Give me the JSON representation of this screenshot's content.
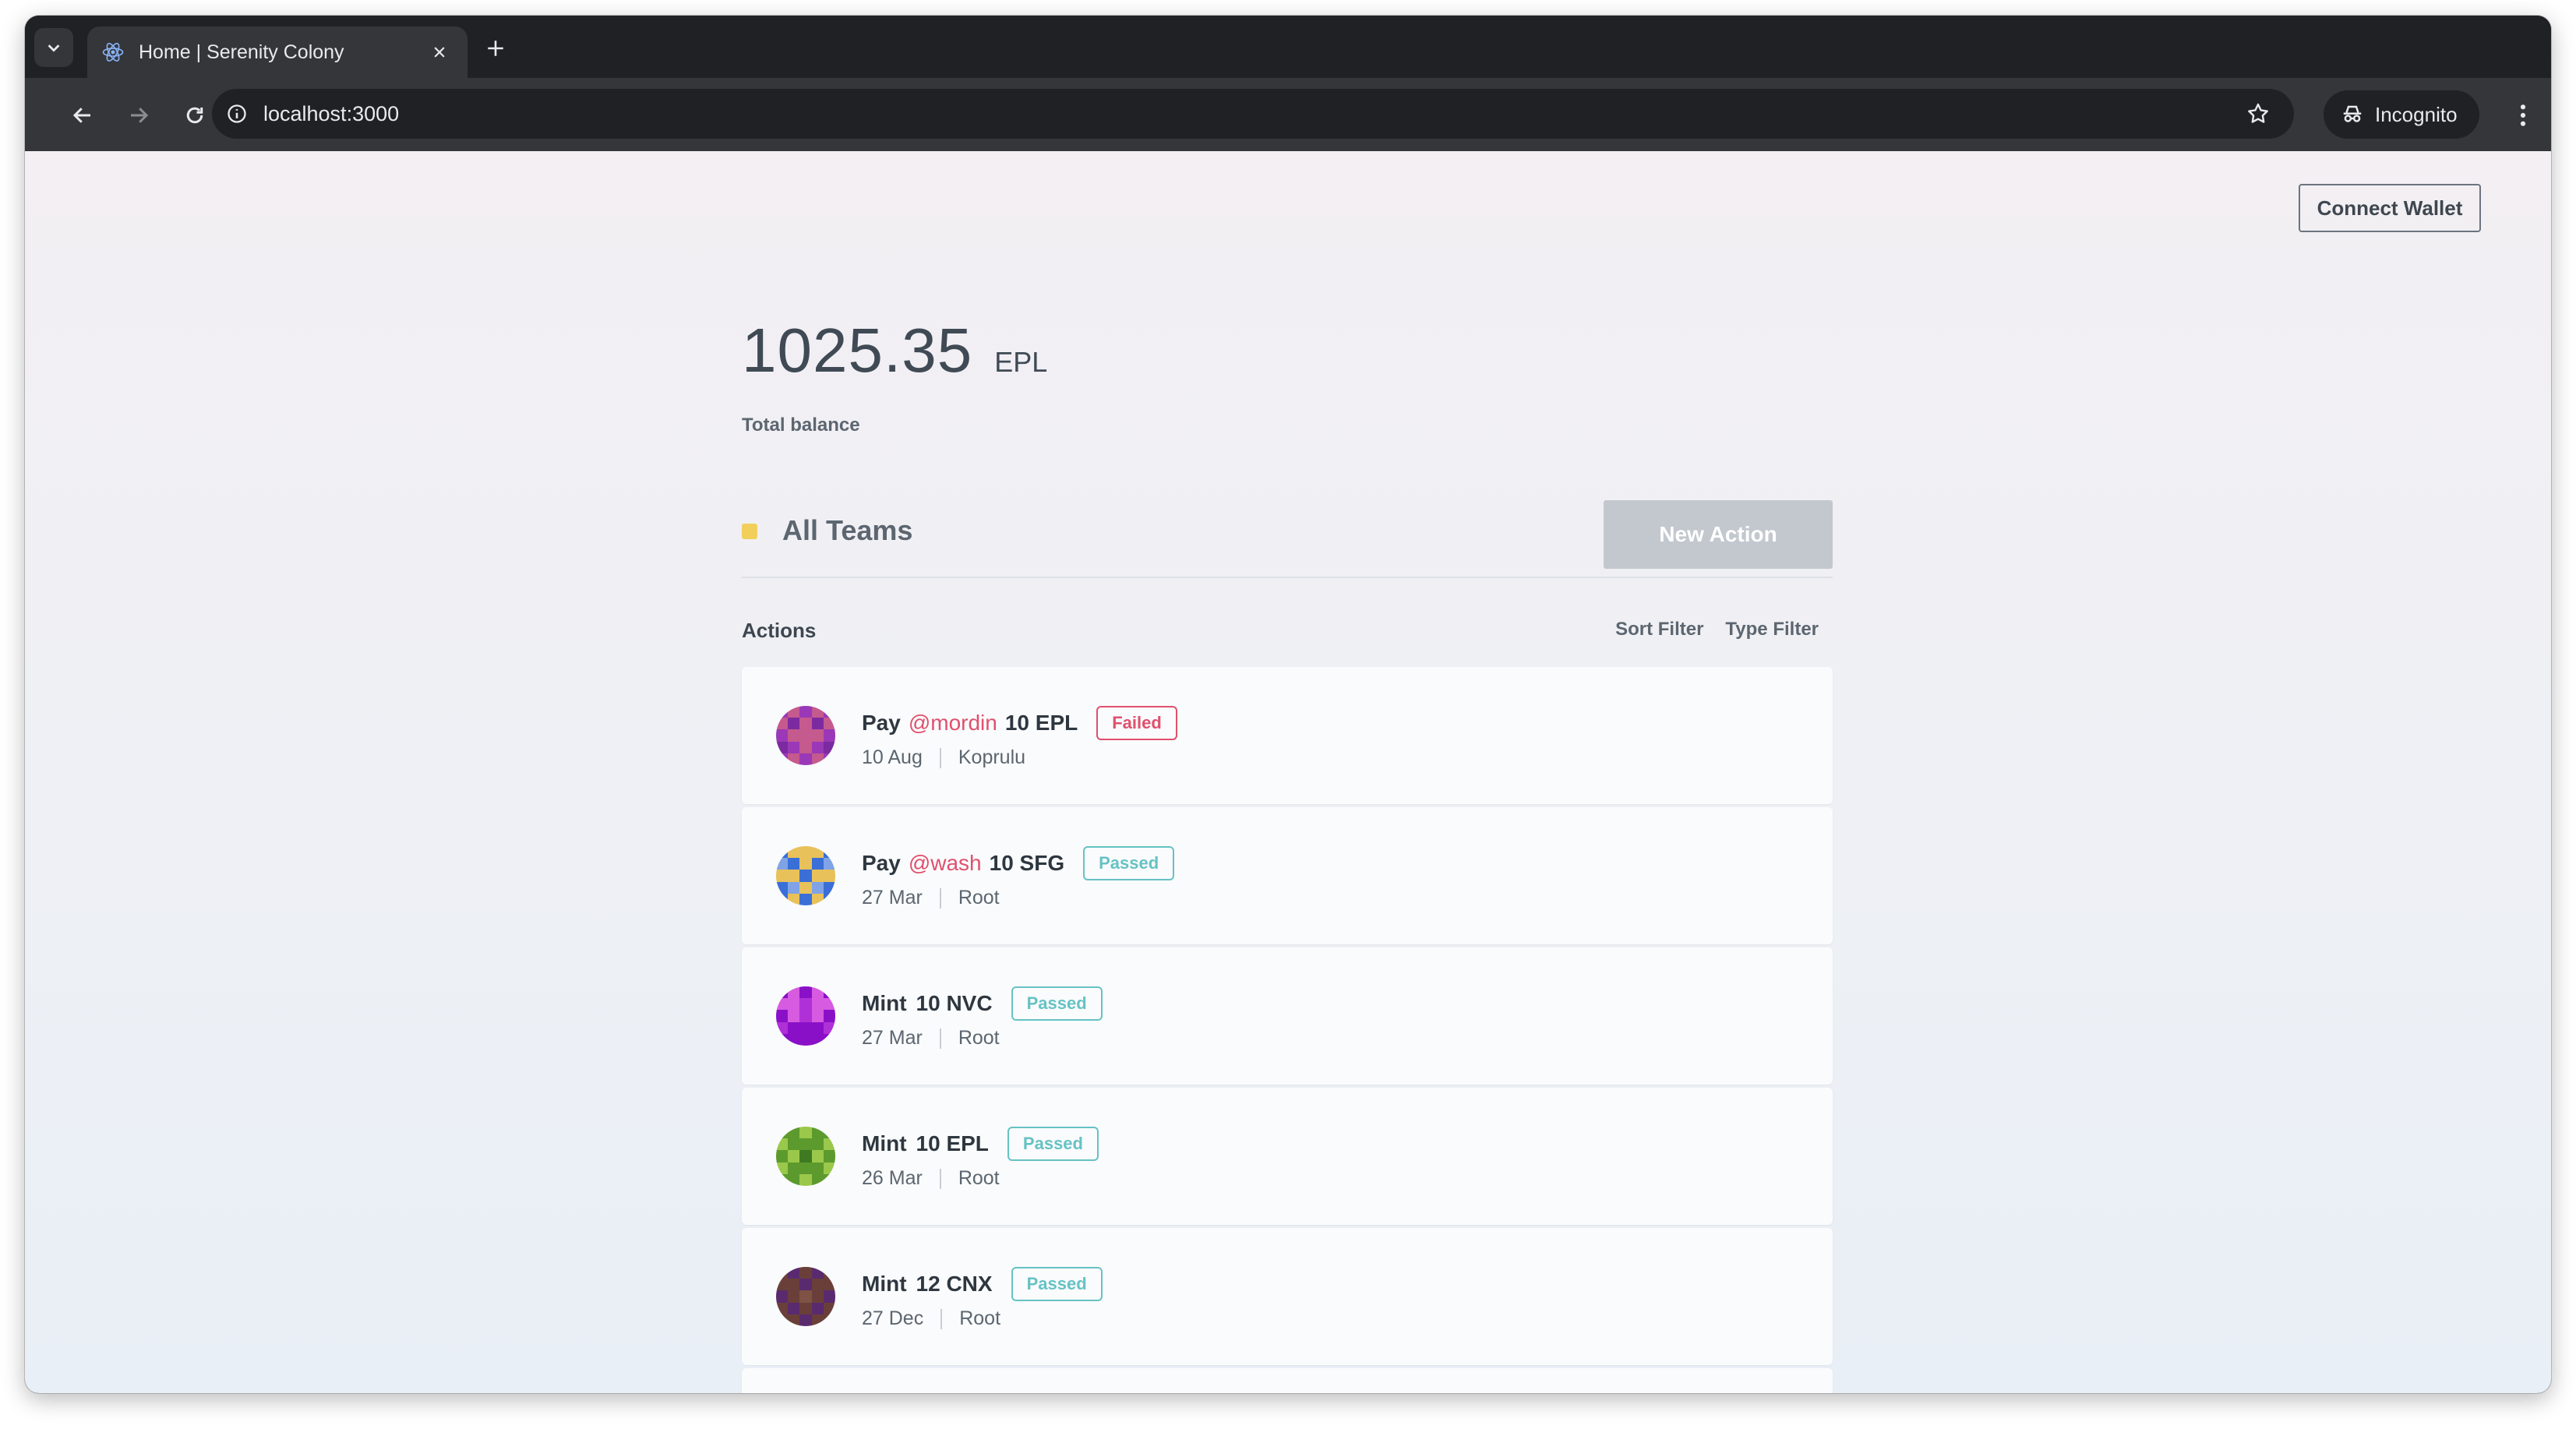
{
  "browser": {
    "tab_title": "Home | Serenity Colony",
    "url": "localhost:3000",
    "incognito_label": "Incognito",
    "icons": {
      "tab_search": "chevron-down-icon",
      "tab_favicon": "react-icon",
      "tab_close": "close-icon",
      "new_tab": "plus-icon",
      "back": "arrow-left-icon",
      "forward": "arrow-right-icon",
      "reload": "reload-icon",
      "site_info": "info-icon",
      "bookmark": "star-icon",
      "incognito": "incognito-icon",
      "menu": "kebab-menu-icon"
    }
  },
  "header": {
    "connect_wallet_label": "Connect Wallet"
  },
  "balance": {
    "value": "1025.35",
    "token": "EPL",
    "label": "Total balance"
  },
  "teams": {
    "selected_team": "All Teams",
    "team_color": "#f2cf5b",
    "new_action_label": "New Action"
  },
  "actions": {
    "title": "Actions",
    "sort_filter_label": "Sort Filter",
    "type_filter_label": "Type Filter",
    "items": [
      {
        "verb": "Pay",
        "recipient": "@mordin",
        "amount": "10 EPL",
        "status": "Failed",
        "date": "10 Aug",
        "team": "Koprulu"
      },
      {
        "verb": "Pay",
        "recipient": "@wash",
        "amount": "10 SFG",
        "status": "Passed",
        "date": "27 Mar",
        "team": "Root"
      },
      {
        "verb": "Mint",
        "recipient": "",
        "amount": "10 NVC",
        "status": "Passed",
        "date": "27 Mar",
        "team": "Root"
      },
      {
        "verb": "Mint",
        "recipient": "",
        "amount": "10 EPL",
        "status": "Passed",
        "date": "26 Mar",
        "team": "Root"
      },
      {
        "verb": "Mint",
        "recipient": "",
        "amount": "12 CNX",
        "status": "Passed",
        "date": "27 Dec",
        "team": "Root"
      }
    ]
  },
  "colors": {
    "failed": "#e0506e",
    "passed": "#66c2c4",
    "mention": "#e0506e"
  }
}
